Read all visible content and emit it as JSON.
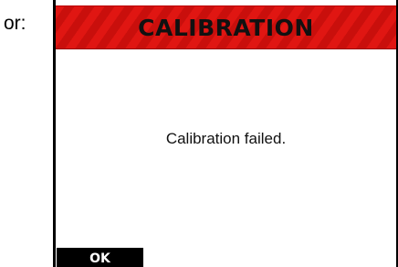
{
  "prefix_label": "or:",
  "dialog": {
    "title": "CALIBRATION",
    "message": "Calibration failed.",
    "ok_label": "OK"
  },
  "colors": {
    "title_bar": "#e01612",
    "title_bar_stripe": "#c90f0c",
    "button_bg": "#000000",
    "button_text": "#ffffff"
  }
}
